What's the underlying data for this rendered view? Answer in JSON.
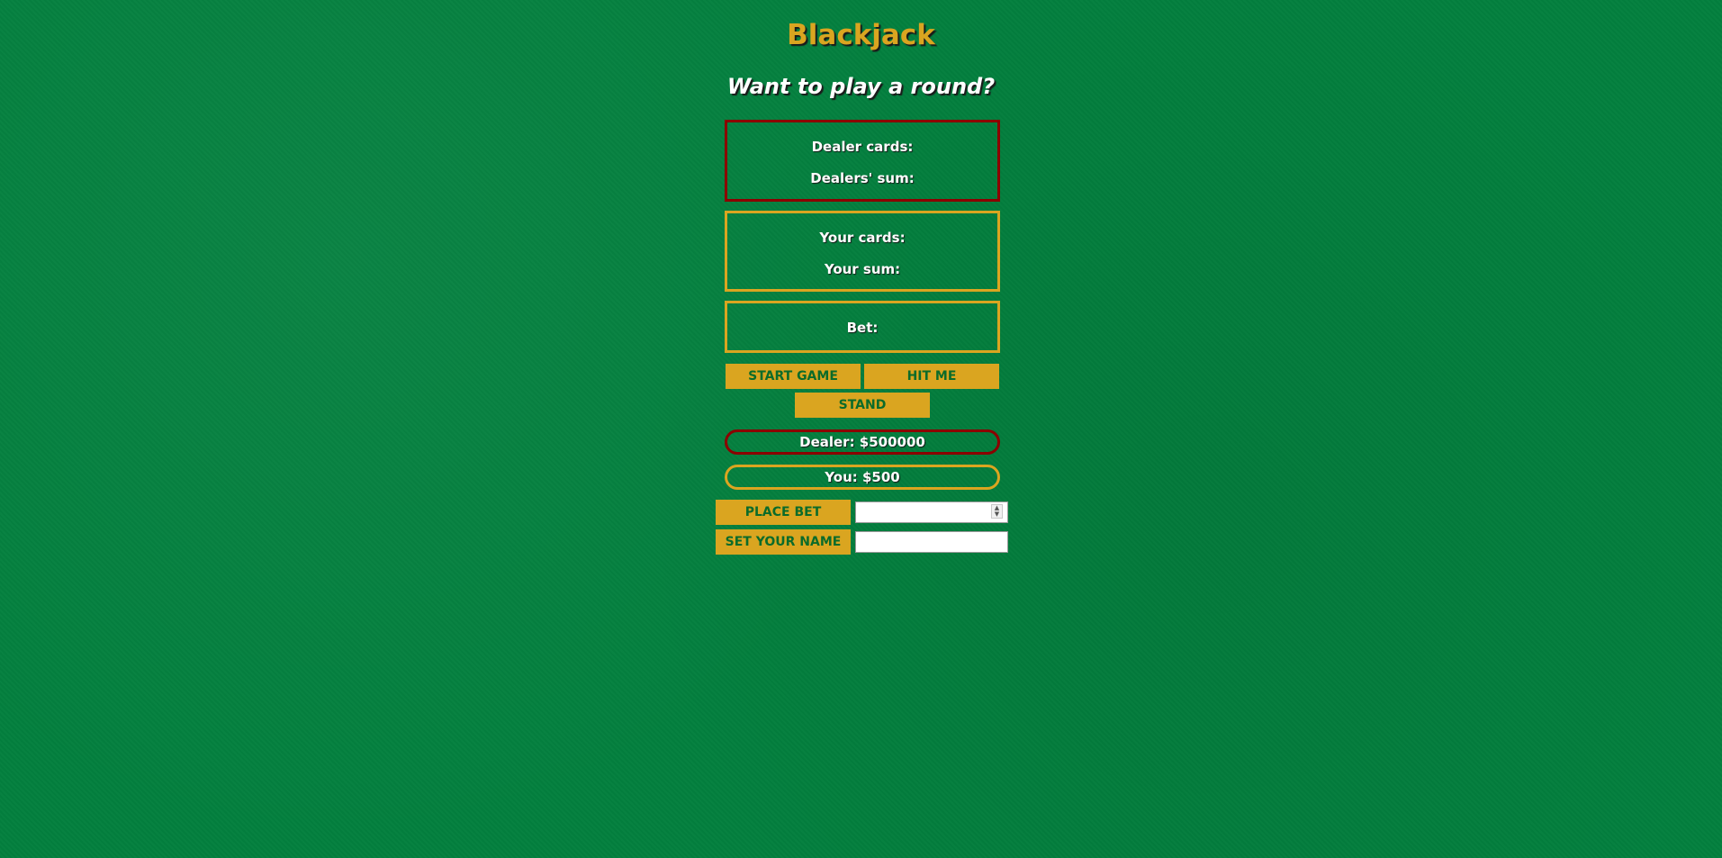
{
  "header": {
    "title": "Blackjack",
    "subtitle": "Want to play a round?"
  },
  "dealer_panel": {
    "cards_label": "Dealer cards:",
    "sum_label": "Dealers' sum:"
  },
  "player_panel": {
    "cards_label": "Your cards:",
    "sum_label": "Your sum:"
  },
  "bet_panel": {
    "label": "Bet:"
  },
  "controls": {
    "start_label": "START GAME",
    "hit_label": "HIT ME",
    "stand_label": "STAND"
  },
  "banks": {
    "dealer": "Dealer: $500000",
    "player": "You: $500"
  },
  "forms": {
    "place_bet_label": "PLACE BET",
    "set_name_label": "SET YOUR NAME",
    "bet_value": "",
    "name_value": ""
  },
  "colors": {
    "felt": "#03803e",
    "gold": "#daa520",
    "dealer_border": "#8b0000",
    "button_text": "#0b6b2a"
  },
  "icons": {
    "spinner": "number-spinner-icon"
  }
}
